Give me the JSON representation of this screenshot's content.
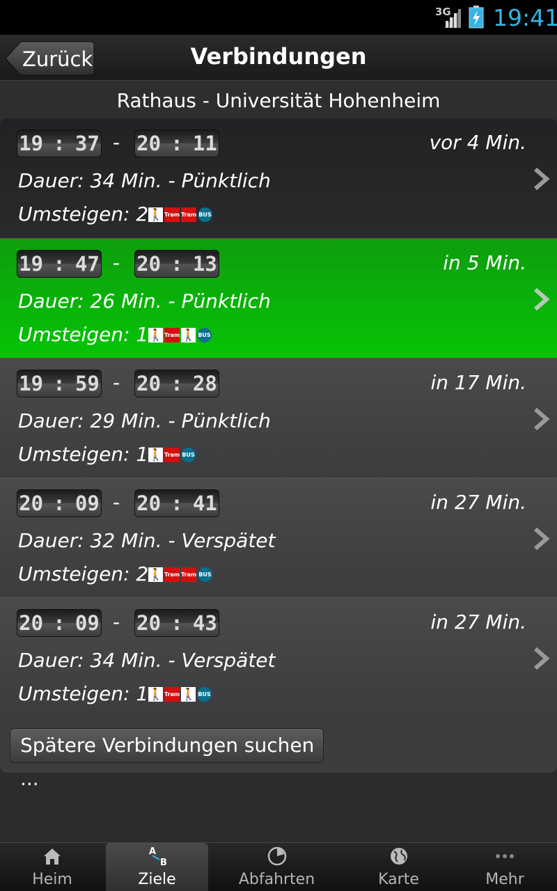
{
  "status": {
    "network": "3G",
    "time": "19:41"
  },
  "header": {
    "back_label": "Zurück",
    "title": "Verbindungen"
  },
  "route": "Rathaus - Universität Hohenheim",
  "connections": [
    {
      "dep_h": "19",
      "dep_m": "37",
      "arr_h": "20",
      "arr_m": "11",
      "relative": "vor 4 Min.",
      "dauer": "Dauer: 34 Min. - Pünktlich",
      "umsteigen": "Umsteigen: 2",
      "modes": [
        "walk",
        "tram",
        "tram",
        "bus"
      ]
    },
    {
      "dep_h": "19",
      "dep_m": "47",
      "arr_h": "20",
      "arr_m": "13",
      "relative": "in 5 Min.",
      "dauer": "Dauer: 26 Min. - Pünktlich",
      "umsteigen": "Umsteigen: 1",
      "modes": [
        "walk",
        "tram",
        "walk",
        "bus"
      ]
    },
    {
      "dep_h": "19",
      "dep_m": "59",
      "arr_h": "20",
      "arr_m": "28",
      "relative": "in 17 Min.",
      "dauer": "Dauer: 29 Min. - Pünktlich",
      "umsteigen": "Umsteigen: 1",
      "modes": [
        "walk",
        "tram",
        "bus"
      ]
    },
    {
      "dep_h": "20",
      "dep_m": "09",
      "arr_h": "20",
      "arr_m": "41",
      "relative": "in 27 Min.",
      "dauer": "Dauer: 32 Min. - Verspätet",
      "umsteigen": "Umsteigen: 2",
      "modes": [
        "walk",
        "tram",
        "tram",
        "bus"
      ]
    },
    {
      "dep_h": "20",
      "dep_m": "09",
      "arr_h": "20",
      "arr_m": "43",
      "relative": "in 27 Min.",
      "dauer": "Dauer: 34 Min. - Verspätet",
      "umsteigen": "Umsteigen: 1",
      "modes": [
        "walk",
        "tram",
        "walk",
        "bus"
      ]
    }
  ],
  "mode_labels": {
    "tram": "Tram",
    "bus": "BUS"
  },
  "time_separator": ":",
  "dash": "-",
  "more_button": "Spätere Verbindungen suchen ...",
  "tabs": [
    {
      "label": "Heim",
      "icon": "home-icon"
    },
    {
      "label": "Ziele",
      "icon": "a-to-b-icon"
    },
    {
      "label": "Abfahrten",
      "icon": "clock-pie-icon"
    },
    {
      "label": "Karte",
      "icon": "globe-icon"
    },
    {
      "label": "Mehr",
      "icon": "more-dots-icon"
    }
  ],
  "tab_icon_text": {
    "a": "A",
    "b": "B"
  },
  "colors": {
    "accent_blue": "#33b5e5",
    "selected_green": "#0aad0a",
    "tram_red": "#d30f10",
    "bus_teal": "#0a6e8c"
  }
}
